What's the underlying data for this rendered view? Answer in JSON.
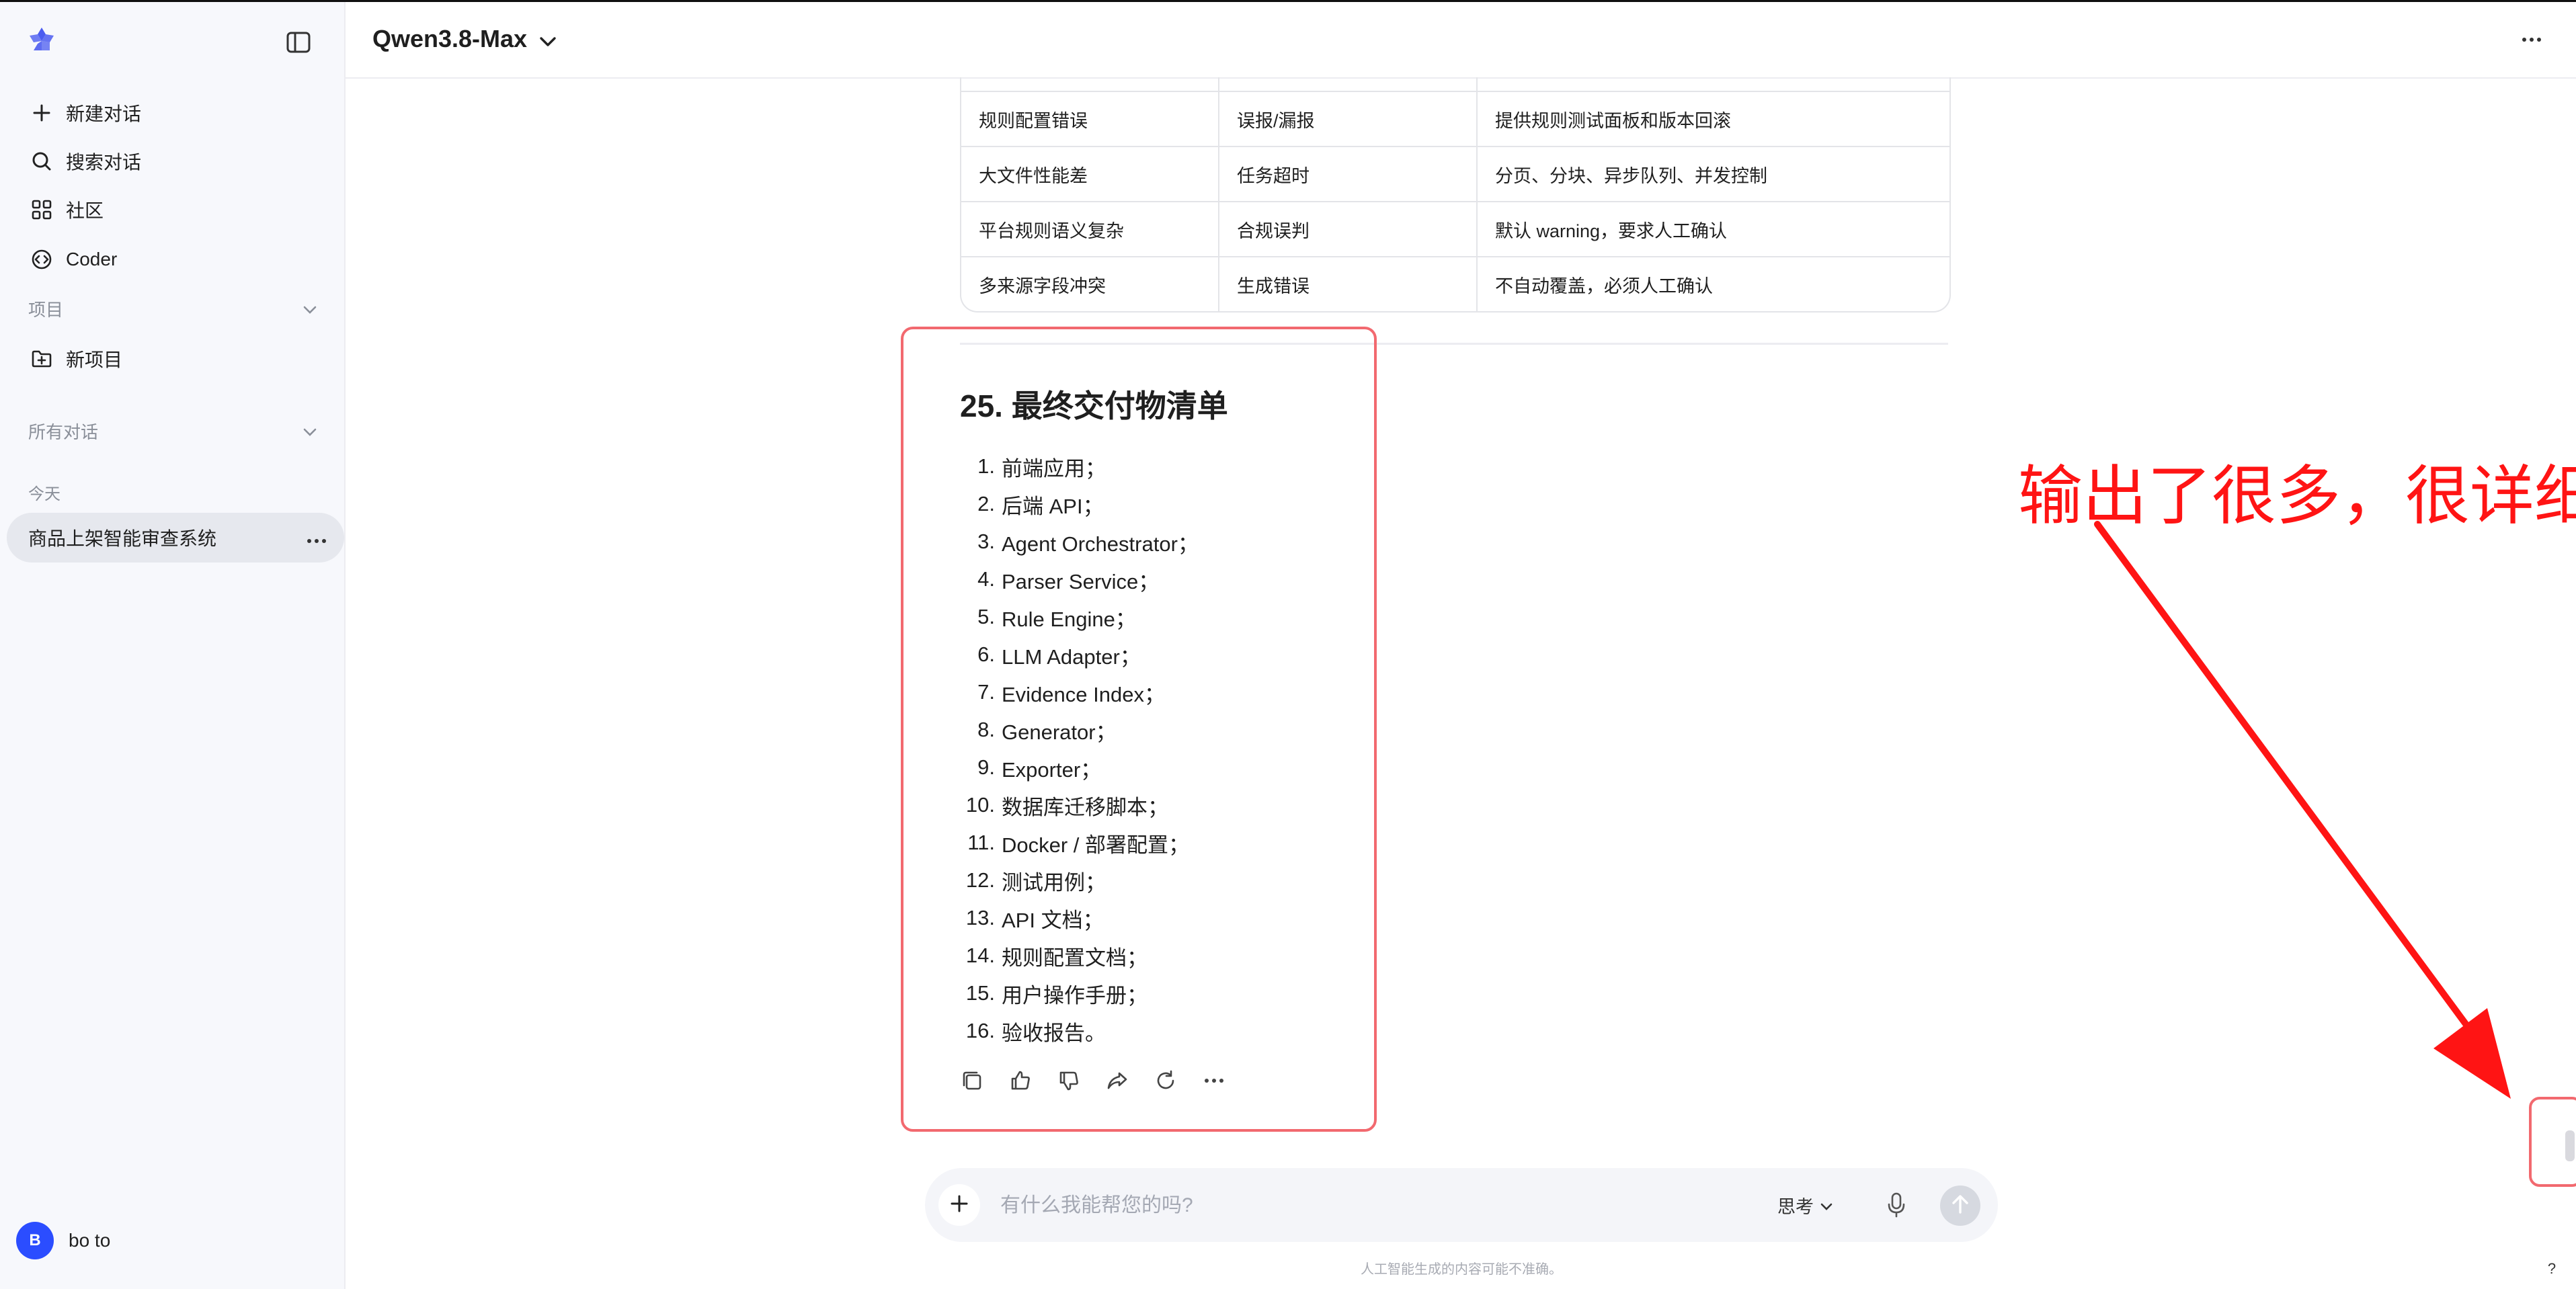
{
  "sidebar": {
    "nav": [
      {
        "label": "新建对话",
        "icon": "plus-icon"
      },
      {
        "label": "搜索对话",
        "icon": "search-icon"
      },
      {
        "label": "社区",
        "icon": "grid-icon"
      },
      {
        "label": "Coder",
        "icon": "code-icon"
      }
    ],
    "projects_label": "项目",
    "new_project_label": "新项目",
    "all_chats_label": "所有对话",
    "today_label": "今天",
    "active_chat": "商品上架智能审查系统",
    "user": {
      "initial": "B",
      "name": "bo to"
    }
  },
  "header": {
    "model_name": "Qwen3.8-Max"
  },
  "table": {
    "rows": [
      [
        "规则配置错误",
        "误报/漏报",
        "提供规则测试面板和版本回滚"
      ],
      [
        "大文件性能差",
        "任务超时",
        "分页、分块、异步队列、并发控制"
      ],
      [
        "平台规则语义复杂",
        "合规误判",
        "默认 warning，要求人工确认"
      ],
      [
        "多来源字段冲突",
        "生成错误",
        "不自动覆盖，必须人工确认"
      ]
    ]
  },
  "section": {
    "title": "25. 最终交付物清单",
    "items": [
      {
        "num": "1.",
        "text": "前端应用；"
      },
      {
        "num": "2.",
        "text": "后端 API；"
      },
      {
        "num": "3.",
        "text": "Agent Orchestrator；"
      },
      {
        "num": "4.",
        "text": "Parser Service；"
      },
      {
        "num": "5.",
        "text": "Rule Engine；"
      },
      {
        "num": "6.",
        "text": "LLM Adapter；"
      },
      {
        "num": "7.",
        "text": "Evidence Index；"
      },
      {
        "num": "8.",
        "text": "Generator；"
      },
      {
        "num": "9.",
        "text": "Exporter；"
      },
      {
        "num": "10.",
        "text": "数据库迁移脚本；"
      },
      {
        "num": "11.",
        "text": "Docker / 部署配置；"
      },
      {
        "num": "12.",
        "text": "测试用例；"
      },
      {
        "num": "13.",
        "text": "API 文档；"
      },
      {
        "num": "14.",
        "text": "规则配置文档；"
      },
      {
        "num": "15.",
        "text": "用户操作手册；"
      },
      {
        "num": "16.",
        "text": "验收报告。"
      }
    ]
  },
  "annotation": {
    "text": "输出了很多，很详细",
    "color": "#ff1414"
  },
  "input": {
    "placeholder": "有什么我能帮您的吗?",
    "think_label": "思考"
  },
  "disclaimer": "人工智能生成的内容可能不准确。",
  "help_label": "?"
}
